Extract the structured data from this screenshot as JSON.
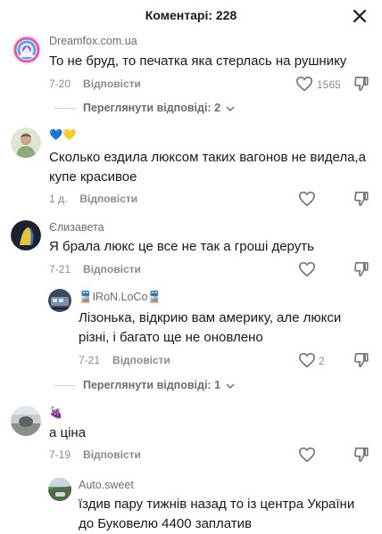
{
  "header": {
    "title": "Коментарі: 228",
    "close_icon": "close-icon"
  },
  "comments": [
    {
      "username": "Dreamfox.com.ua",
      "text": "То не бруд, то печатка яка стерлась на рушнику",
      "date": "7-20",
      "reply_label": "Відповісти",
      "likes": "1565",
      "view_replies": "Переглянути відповіді: 2"
    },
    {
      "username": "💙💛",
      "text_line1": "Сколько ездила люксом таких вагонов не видела,а",
      "text_line2": "купе красивое",
      "date": "1 д.",
      "reply_label": "Відповісти"
    },
    {
      "username": "Єлизавета",
      "text": "Я брала люкс це все не так а гроші деруть",
      "date": "7-21",
      "reply_label": "Відповісти"
    },
    {
      "reply": true,
      "username": "🚆IRoN.LoCo🚆",
      "text_line1": "Лізонька, відкрию вам америку, але люкси",
      "text_line2": "різні, і багато ще не оновлено",
      "date": "7-21",
      "reply_label": "Відповісти",
      "likes": "2",
      "view_replies": "Переглянути відповіді: 1"
    },
    {
      "username": "🍇",
      "text": "а ціна",
      "date": "7-19",
      "reply_label": "Відповісти"
    },
    {
      "reply": true,
      "username": "Auto.sweet",
      "text_line1": "їздив пару тижнів назад то із центра України",
      "text_line2": "до Буковелю 4400 заплатив"
    }
  ],
  "colors": {
    "text": "#161823",
    "muted": "#8a8b91",
    "username": "#6b6d73"
  }
}
